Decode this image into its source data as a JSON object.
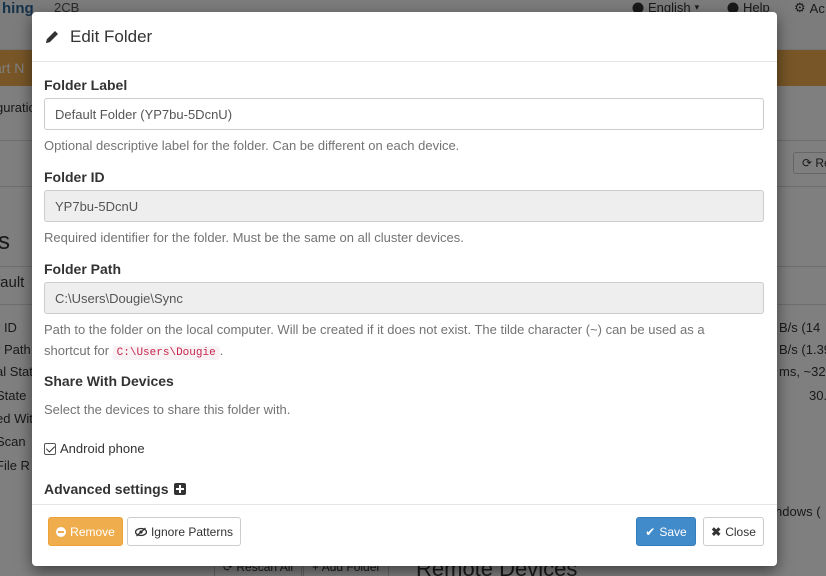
{
  "background": {
    "brand": "hing",
    "brand_sub": "2CB",
    "nav": {
      "language": "English",
      "help": "Help",
      "actions": "Ac"
    },
    "banner_text": "art N",
    "config_text": "guratio",
    "section_title": "s",
    "folder_name_partial": "fault",
    "left_labels": [
      "r ID",
      "r Path",
      "al Stat",
      "State",
      "ed Wit",
      "Scan",
      "File R"
    ],
    "right_values": [
      "B/s (14",
      "B/s (1.39",
      "ms, ~32",
      "30."
    ],
    "right_windows": "ndows (",
    "refresh_btn": "Re",
    "rescan_all": "Rescan All",
    "add_folder": "Add Folder",
    "remote_devices": "Remote Devices"
  },
  "modal": {
    "title": "Edit Folder",
    "folder_label": {
      "label": "Folder Label",
      "value": "Default Folder (YP7bu-5DcnU)",
      "help": "Optional descriptive label for the folder. Can be different on each device."
    },
    "folder_id": {
      "label": "Folder ID",
      "value": "YP7bu-5DcnU",
      "help": "Required identifier for the folder. Must be the same on all cluster devices."
    },
    "folder_path": {
      "label": "Folder Path",
      "value": "C:\\Users\\Dougie\\Sync",
      "help_line1": "Path to the folder on the local computer. Will be created if it does not exist. The tilde character (~) can be used as a",
      "help_line2_prefix": "shortcut for",
      "help_code": "C:\\Users\\Dougie",
      "help_line2_suffix": "."
    },
    "share": {
      "label": "Share With Devices",
      "help": "Select the devices to share this folder with.",
      "devices": [
        {
          "name": "Android phone",
          "checked": true
        }
      ]
    },
    "advanced": {
      "label": "Advanced settings"
    },
    "footer": {
      "remove": "Remove",
      "ignore_patterns": "Ignore Patterns",
      "save": "Save",
      "close": "Close"
    }
  }
}
